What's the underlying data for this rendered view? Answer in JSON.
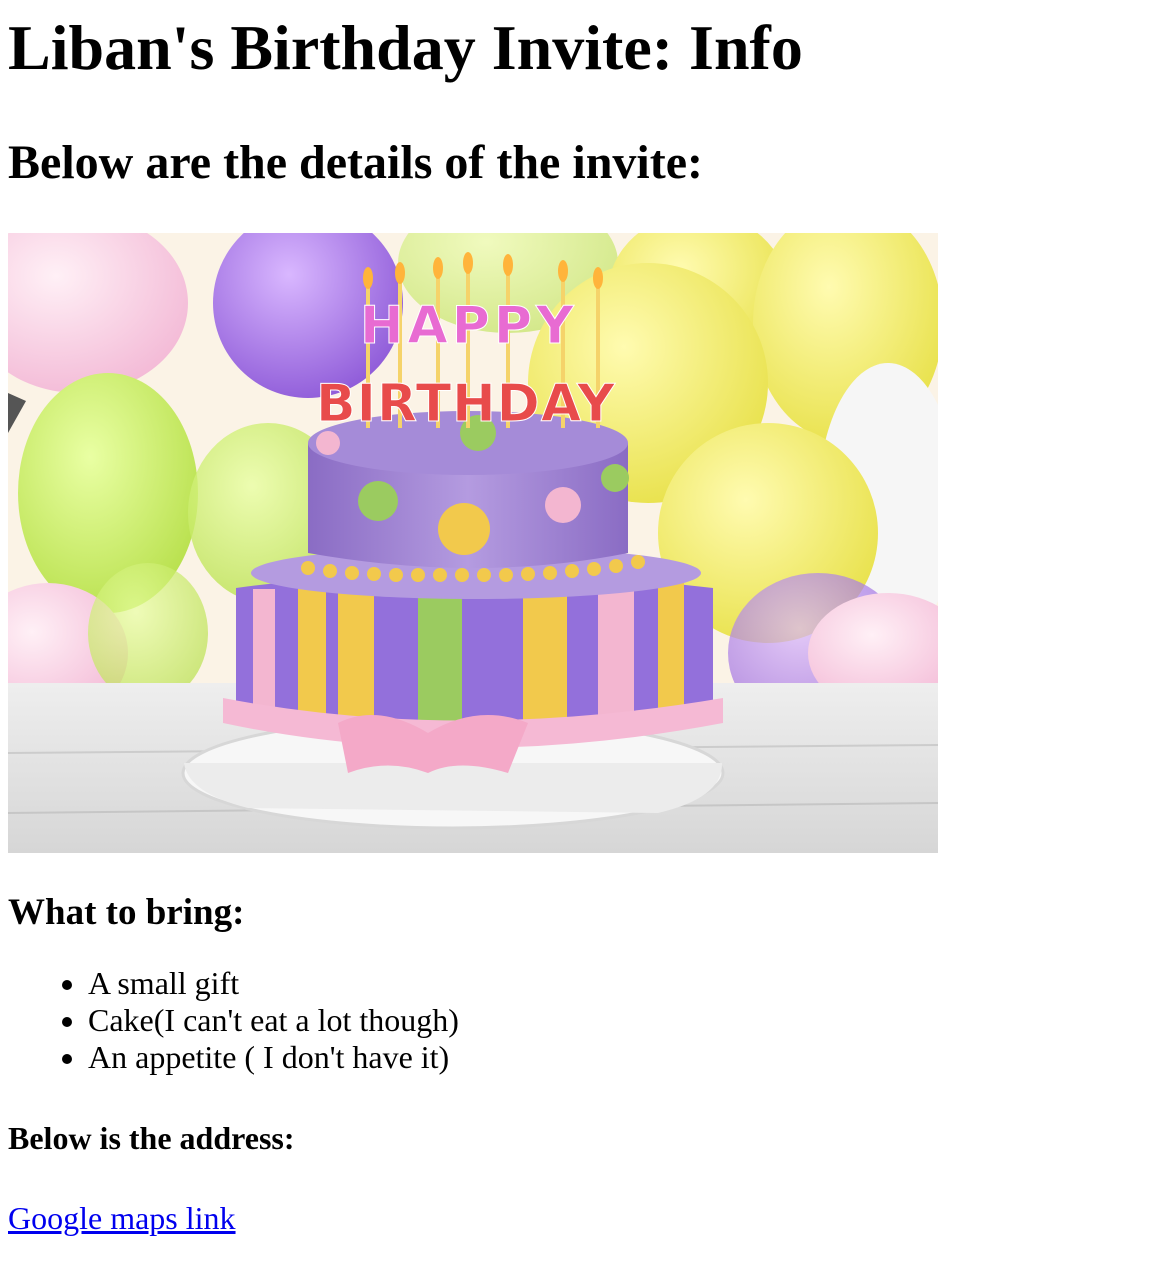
{
  "page": {
    "title": "Liban's Birthday Invite: Info",
    "subtitle": "Below are the details of the invite:"
  },
  "image": {
    "alt": "Birthday cake with Happy Birthday candles and balloons",
    "candle_text_top": "HAPPY",
    "candle_text_bottom": "BIRTHDAY"
  },
  "bring": {
    "heading": "What to bring:",
    "items": [
      "A small gift",
      "Cake(I can't eat a lot though)",
      "An appetite ( I don't have it)"
    ]
  },
  "address": {
    "heading": "Below is the address:",
    "link_text": "Google maps link"
  },
  "colors": {
    "link": "#0000ee",
    "text": "#000000",
    "background": "#ffffff"
  }
}
